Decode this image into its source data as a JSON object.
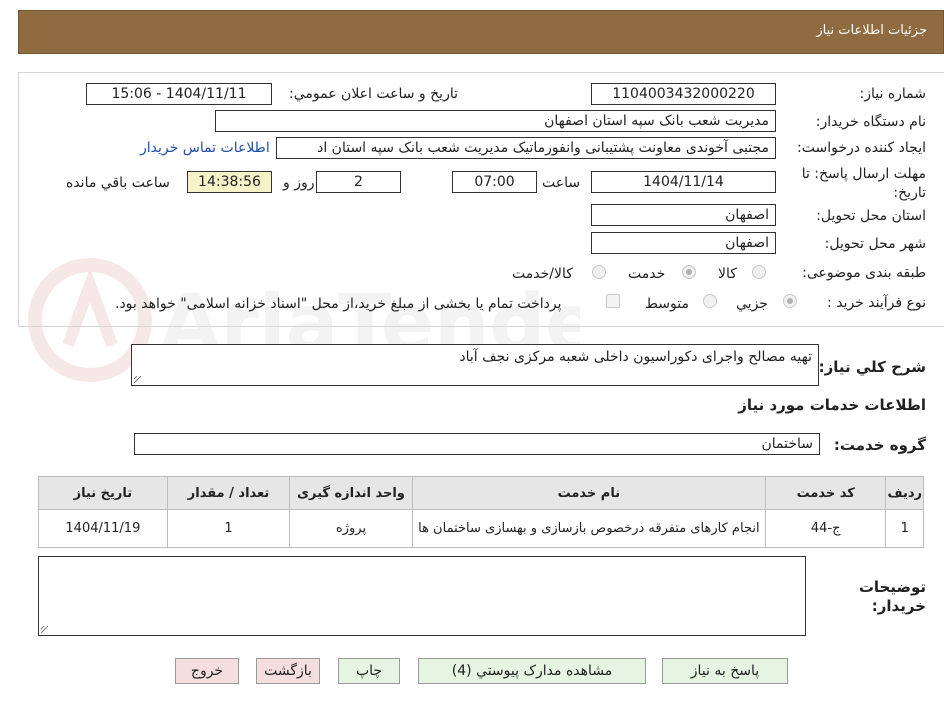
{
  "header": {
    "title": "جزئیات اطلاعات نیاز"
  },
  "form": {
    "need_number_label": "شماره نیاز:",
    "need_number": "1104003432000220",
    "announce_label": "تاریخ و ساعت اعلان عمومي:",
    "announce_value": "1404/11/11 - 15:06",
    "buyer_label": "نام دستگاه خریدار:",
    "buyer_value": "مدیریت شعب بانک سپه استان اصفهان",
    "requester_label": "ایجاد کننده درخواست:",
    "requester_value": "مجتبی آخوندی معاونت پشتیبانی وانفورماتیک مدیریت شعب بانک سپه استان اد",
    "contact_link": "اطلاعات تماس خریدار",
    "deadline_label": "مهلت ارسال پاسخ: تا تاریخ:",
    "deadline_date": "1404/11/14",
    "time_label": "ساعت",
    "deadline_time": "07:00",
    "days_value": "2",
    "days_label": "روز و",
    "remaining_value": "14:38:56",
    "remaining_label": "ساعت باقي مانده",
    "province_label": "استان محل تحویل:",
    "province_value": "اصفهان",
    "city_label": "شهر محل تحویل:",
    "city_value": "اصفهان",
    "category_label": "طبقه بندی موضوعی:",
    "category_options": [
      "کالا",
      "خدمت",
      "کالا/خدمت"
    ],
    "category_selected": "خدمت",
    "process_label": "نوع فرآیند خرید :",
    "process_options": [
      "جزیي",
      "متوسط"
    ],
    "process_selected": "جزیي",
    "payment_note": "پرداخت تمام یا بخشی از مبلغ خرید،از محل \"اسناد خزانه اسلامی\" خواهد بود."
  },
  "description": {
    "label": "شرح کلي نیاز:",
    "value": "تهیه مصالح واجرای دکوراسیون داخلی شعبه مرکزی نجف آباد"
  },
  "services": {
    "section_title": "اطلاعات خدمات مورد نیاز",
    "group_label": "گروه خدمت:",
    "group_value": "ساختمان",
    "columns": [
      "ردیف",
      "کد خدمت",
      "نام خدمت",
      "واحد اندازه گیری",
      "تعداد / مقدار",
      "تاریخ نیاز"
    ],
    "rows": [
      {
        "index": "1",
        "code": "ج-44",
        "name": "انجام کارهای متفرقه درخصوص بازسازی و بهسازی ساختمان ها",
        "unit": "پروژه",
        "qty": "1",
        "date": "1404/11/19"
      }
    ]
  },
  "buyer_notes": {
    "label": "توضیحات خریدار:",
    "value": ""
  },
  "buttons": {
    "reply": "پاسخ به نیاز",
    "attachments": "مشاهده مدارک پیوستي (4)",
    "print": "چاپ",
    "back": "بازگشت",
    "exit": "خروج"
  },
  "watermark": {
    "text": "AriaTender.neT"
  },
  "colors": {
    "header_bg": "#8f6b3f",
    "yellow_box": "#f6f3c9",
    "green_button": "#e6f5e1",
    "red_button": "#f5dede",
    "link": "#1f4ea8"
  }
}
